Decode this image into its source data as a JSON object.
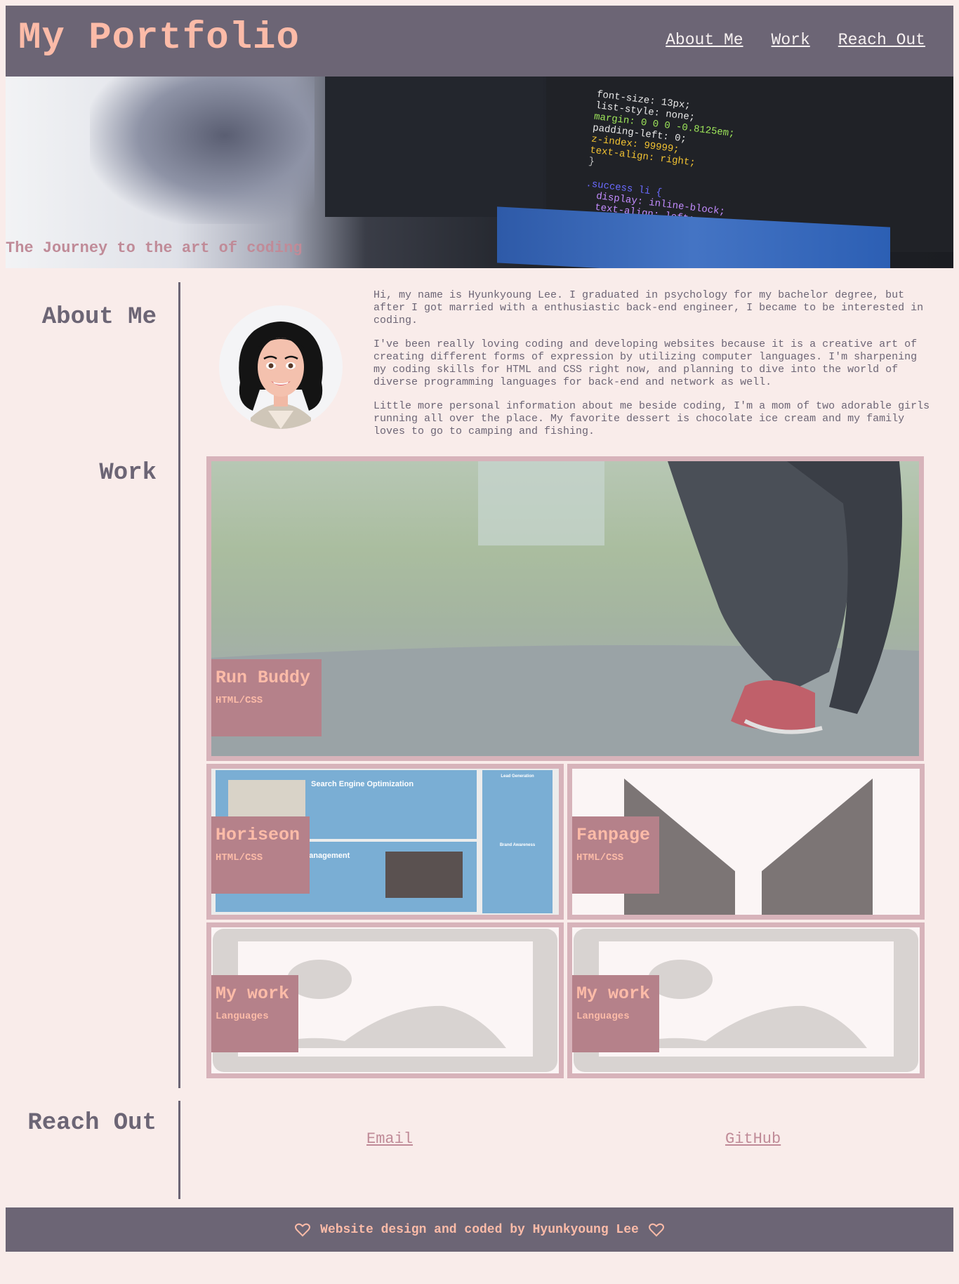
{
  "header": {
    "logo": "My Portfolio",
    "nav": [
      "About Me",
      "Work",
      "Reach Out"
    ]
  },
  "hero": {
    "tagline": "The Journey to the art of coding",
    "code_lines": [
      "font-size: 13px;",
      "list-style: none;",
      "margin: 0 0 0 -0.8125em;",
      "padding-left: 0;",
      "z-index: 99999;",
      "text-align: right;",
      "}",
      "",
      ".success li {",
      "  display: inline-block;",
      "  text-align: left;"
    ]
  },
  "about": {
    "title": "About Me",
    "paragraphs": [
      "Hi, my name is Hyunkyoung Lee. I graduated in psychology for my bachelor degree, but after I got married with a enthusiastic back-end engineer, I became to be interested in coding.",
      "I've been really loving coding and developing websites because it is a creative art of creating different forms of expression by utilizing computer languages. I'm sharpening my coding skills for HTML and CSS right now, and planning to dive into the world of diverse programming languages for back-end and network as well.",
      "Little more personal information about me beside coding, I'm a mom of two adorable girls running all over the place. My favorite dessert is chocolate ice cream and my family loves to go to camping and fishing."
    ]
  },
  "work": {
    "title": "Work",
    "projects": [
      {
        "title": "Run Buddy",
        "subtitle": "HTML/CSS"
      },
      {
        "title": "Horiseon",
        "subtitle": "HTML/CSS"
      },
      {
        "title": "Fanpage",
        "subtitle": "HTML/CSS"
      },
      {
        "title": "My work",
        "subtitle": "Languages"
      },
      {
        "title": "My work",
        "subtitle": "Languages"
      }
    ],
    "horiseon_preview": {
      "heading1": "Search Engine Optimization",
      "heading2": "Management",
      "side1": "Lead Generation",
      "side2": "Brand Awareness"
    }
  },
  "reach": {
    "title": "Reach Out",
    "links": [
      "Email",
      "GitHub"
    ]
  },
  "footer": {
    "text": "Website design and coded by Hyunkyoung Lee"
  },
  "colors": {
    "background": "#f9ecea",
    "header": "#6c6575",
    "accent": "#fcbba8",
    "label": "#b5818a",
    "card_border": "#d7b3ba"
  }
}
